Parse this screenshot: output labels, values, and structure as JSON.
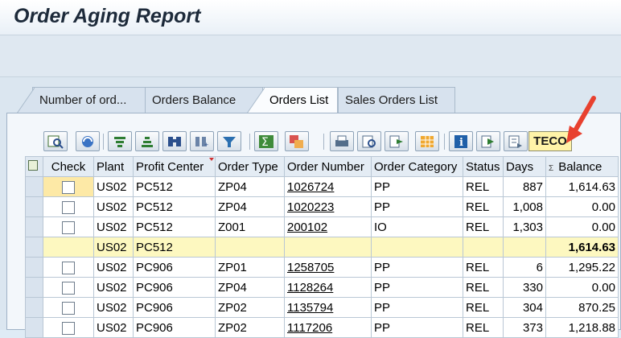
{
  "window": {
    "title": "Order Aging Report"
  },
  "tabs": [
    {
      "label": "Number of ord..."
    },
    {
      "label": "Orders Balance"
    },
    {
      "label": "Orders List",
      "active": true
    },
    {
      "label": "Sales Orders List"
    }
  ],
  "toolbar": {
    "teco_label": "TECO",
    "icons": [
      "details-icon",
      "refresh-icon",
      "sort-ascending-icon",
      "sort-descending-icon",
      "find-icon",
      "find-next-icon",
      "filter-icon",
      "total-icon",
      "subtotal-icon",
      "print-icon",
      "print-preview-icon",
      "export-icon",
      "change-layout-icon",
      "info-icon",
      "navigate-icon",
      "display-icon"
    ]
  },
  "table": {
    "columns": [
      "Check",
      "Plant",
      "Profit Center",
      "Order Type",
      "Order Number",
      "Order Category",
      "Status",
      "Days",
      "Balance"
    ],
    "rows": [
      {
        "plant": "US02",
        "profit_center": "PC512",
        "order_type": "ZP04",
        "order_number": "1026724",
        "order_category": "PP",
        "status": "REL",
        "days": "887",
        "balance": "1,614.63"
      },
      {
        "plant": "US02",
        "profit_center": "PC512",
        "order_type": "ZP04",
        "order_number": "1020223",
        "order_category": "PP",
        "status": "REL",
        "days": "1,008",
        "balance": "0.00"
      },
      {
        "plant": "US02",
        "profit_center": "PC512",
        "order_type": "Z001",
        "order_number": "200102",
        "order_category": "IO",
        "status": "REL",
        "days": "1,303",
        "balance": "0.00"
      },
      {
        "subtotal": true,
        "plant": "US02",
        "profit_center": "PC512",
        "balance": "1,614.63"
      },
      {
        "plant": "US02",
        "profit_center": "PC906",
        "order_type": "ZP01",
        "order_number": "1258705",
        "order_category": "PP",
        "status": "REL",
        "days": "6",
        "balance": "1,295.22"
      },
      {
        "plant": "US02",
        "profit_center": "PC906",
        "order_type": "ZP04",
        "order_number": "1128264",
        "order_category": "PP",
        "status": "REL",
        "days": "330",
        "balance": "0.00"
      },
      {
        "plant": "US02",
        "profit_center": "PC906",
        "order_type": "ZP02",
        "order_number": "1135794",
        "order_category": "PP",
        "status": "REL",
        "days": "304",
        "balance": "870.25"
      },
      {
        "plant": "US02",
        "profit_center": "PC906",
        "order_type": "ZP02",
        "order_number": "1117206",
        "order_category": "PP",
        "status": "REL",
        "days": "373",
        "balance": "1,218.88"
      }
    ]
  },
  "colors": {
    "teco_highlight": "#fff3a8",
    "subtotal_row": "#fdf8c0",
    "arrow": "#e8412f"
  }
}
